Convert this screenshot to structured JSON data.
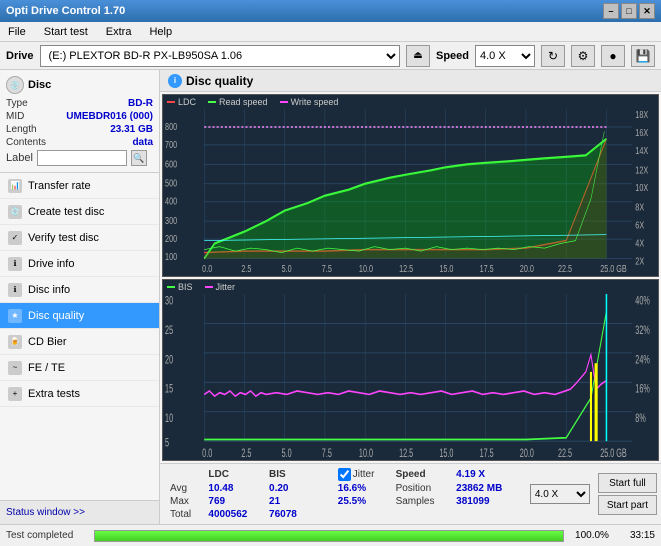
{
  "titleBar": {
    "title": "Opti Drive Control 1.70",
    "minimizeLabel": "–",
    "maximizeLabel": "□",
    "closeLabel": "✕"
  },
  "menuBar": {
    "items": [
      "File",
      "Start test",
      "Extra",
      "Help"
    ]
  },
  "driveBar": {
    "driveLabel": "Drive",
    "driveValue": "(E:)  PLEXTOR BD-R  PX-LB950SA 1.06",
    "speedLabel": "Speed",
    "speedValue": "4.0 X"
  },
  "disc": {
    "title": "Disc",
    "typeLabel": "Type",
    "typeValue": "BD-R",
    "midLabel": "MID",
    "midValue": "UMEBDR016 (000)",
    "lengthLabel": "Length",
    "lengthValue": "23.31 GB",
    "contentsLabel": "Contents",
    "contentsValue": "data",
    "labelLabel": "Label",
    "labelValue": ""
  },
  "navItems": [
    {
      "id": "transfer-rate",
      "label": "Transfer rate",
      "active": false
    },
    {
      "id": "create-test-disc",
      "label": "Create test disc",
      "active": false
    },
    {
      "id": "verify-test-disc",
      "label": "Verify test disc",
      "active": false
    },
    {
      "id": "drive-info",
      "label": "Drive info",
      "active": false
    },
    {
      "id": "disc-info",
      "label": "Disc info",
      "active": false
    },
    {
      "id": "disc-quality",
      "label": "Disc quality",
      "active": true
    },
    {
      "id": "cd-bier",
      "label": "CD Bier",
      "active": false
    },
    {
      "id": "fe-te",
      "label": "FE / TE",
      "active": false
    },
    {
      "id": "extra-tests",
      "label": "Extra tests",
      "active": false
    }
  ],
  "sidebarStatus": "Status window >>",
  "panel": {
    "title": "Disc quality"
  },
  "chart1": {
    "legend": [
      {
        "label": "LDC",
        "color": "#ff4444"
      },
      {
        "label": "Read speed",
        "color": "#44ff44"
      },
      {
        "label": "Write speed",
        "color": "#ff44ff"
      }
    ],
    "yLabelsRight": [
      "18X",
      "16X",
      "14X",
      "12X",
      "10X",
      "8X",
      "6X",
      "4X",
      "2X"
    ],
    "yLabelsLeft": [
      "800",
      "700",
      "600",
      "500",
      "400",
      "300",
      "200",
      "100"
    ],
    "xLabels": [
      "0.0",
      "2.5",
      "5.0",
      "7.5",
      "10.0",
      "12.5",
      "15.0",
      "17.5",
      "20.0",
      "22.5",
      "25.0"
    ]
  },
  "chart2": {
    "legend": [
      {
        "label": "BIS",
        "color": "#44ff44"
      },
      {
        "label": "Jitter",
        "color": "#ff44ff"
      }
    ],
    "yLabelsRight": [
      "40%",
      "32%",
      "24%",
      "16%",
      "8%"
    ],
    "yLabelsLeft": [
      "30",
      "25",
      "20",
      "15",
      "10",
      "5"
    ],
    "xLabels": [
      "0.0",
      "2.5",
      "5.0",
      "7.5",
      "10.0",
      "12.5",
      "15.0",
      "17.5",
      "20.0",
      "22.5",
      "25.0"
    ]
  },
  "stats": {
    "columns": [
      "",
      "LDC",
      "BIS",
      "",
      "Jitter",
      "Speed",
      ""
    ],
    "avgLabel": "Avg",
    "maxLabel": "Max",
    "totalLabel": "Total",
    "avgLDC": "10.48",
    "maxLDC": "769",
    "totalLDC": "4000562",
    "avgBIS": "0.20",
    "maxBIS": "21",
    "totalBIS": "76078",
    "avgJitter": "16.6%",
    "maxJitter": "25.5%",
    "speedLabel": "Speed",
    "speedValue": "4.19 X",
    "speedSelect": "4.0 X",
    "positionLabel": "Position",
    "positionValue": "23862 MB",
    "samplesLabel": "Samples",
    "samplesValue": "381099",
    "jitterChecked": true,
    "startFullLabel": "Start full",
    "startPartLabel": "Start part"
  },
  "bottomBar": {
    "statusText": "Test completed",
    "progressValue": 100,
    "progressPct": "100.0%",
    "timeValue": "33:15"
  }
}
